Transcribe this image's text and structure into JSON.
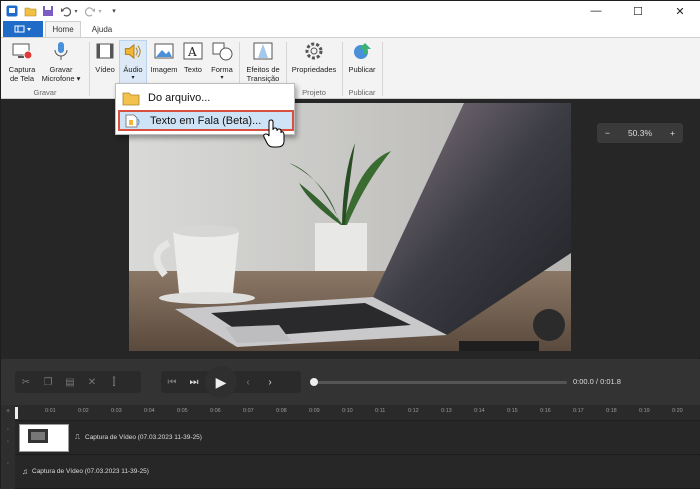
{
  "titlebar": {
    "icons": [
      "app-icon",
      "open-icon",
      "save-icon",
      "undo-icon",
      "redo-icon",
      "customize-icon"
    ],
    "minimize": "—",
    "maximize": "☐",
    "close": "✕"
  },
  "tabs": {
    "file_icon": "menu-icon",
    "home": "Home",
    "help": "Ajuda"
  },
  "ribbon": {
    "capture_screen": "Captura de Tela",
    "record_mic": "Gravar Microfone ▾",
    "group_record": "Gravar",
    "video": "Vídeo",
    "audio": "Áudio",
    "image": "Imagem",
    "text": "Texto",
    "shape": "Forma",
    "transition_effects": "Efeitos de Transição",
    "properties": "Propriedades",
    "publish": "Publicar",
    "group_project": "Projeto",
    "group_publish": "Publicar"
  },
  "dropdown": {
    "from_file": "Do arquivo...",
    "tts": "Texto em Fala (Beta)..."
  },
  "zoom": {
    "minus": "−",
    "value": "50.3%",
    "plus": "+"
  },
  "player": {
    "time": "0:00.0 / 0:01.8"
  },
  "ruler": [
    "0:01",
    "0:02",
    "0:03",
    "0:04",
    "0:05",
    "0:06",
    "0:07",
    "0:08",
    "0:09",
    "0:10",
    "0:11",
    "0:12",
    "0:13",
    "0:14",
    "0:15",
    "0:16",
    "0:17",
    "0:18",
    "0:19",
    "0:20"
  ],
  "tracks": {
    "video_label": "Captura de Vídeo (07.03.2023 11-39-25)",
    "audio_label": "Captura de Vídeo (07.03.2023 11-39-25)"
  },
  "colors": {
    "accent": "#1e6bc8",
    "highlight_border": "#d9503f"
  }
}
